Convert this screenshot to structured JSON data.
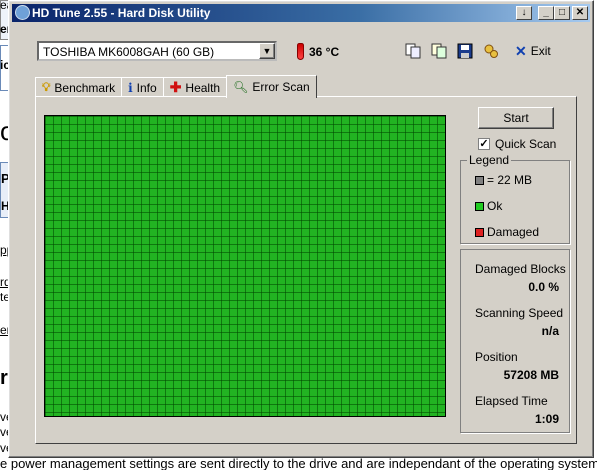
{
  "background": {
    "frag_top1": "ea",
    "frag_top2": "emp",
    "frag_ice": "ice",
    "frag_o": "o",
    "frag_pr": "Pr",
    "frag_hd": "HD",
    "frag_ppo": "ppo",
    "frag_rdw": "rdw",
    "frag_te": "te:",
    "frag_ens": "ens",
    "frag_riv": "riv",
    "frag_ve": "ve",
    "frag_ves1": "ves.",
    "frag_ves2": "ves.",
    "frag_right1": ",",
    "bottom_text": "e power management settings are sent directly to the drive and are independant of the operating system"
  },
  "window": {
    "title": "HD Tune 2.55 - Hard Disk Utility",
    "btn_help": "↓",
    "btn_min": "_",
    "btn_max": "□",
    "btn_close": "✕"
  },
  "toolbar": {
    "drive": "TOSHIBA MK6008GAH (60 GB)",
    "temperature": "36 °C",
    "exit_label": "Exit"
  },
  "tabs": [
    {
      "label": "Benchmark",
      "icon": "benchmark-icon"
    },
    {
      "label": "Info",
      "icon": "info-icon"
    },
    {
      "label": "Health",
      "icon": "health-icon"
    },
    {
      "label": "Error Scan",
      "icon": "magnifier-icon",
      "active": true
    }
  ],
  "scan": {
    "start_label": "Start",
    "quick_scan_label": "Quick Scan",
    "quick_scan_checked": true,
    "block_color": "#22b322"
  },
  "legend": {
    "title": "Legend",
    "items": [
      {
        "label": "= 22 MB",
        "color": "#808080"
      },
      {
        "label": "Ok",
        "color": "#22cc22"
      },
      {
        "label": "Damaged",
        "color": "#dd2222"
      }
    ]
  },
  "stats": {
    "damaged_label": "Damaged Blocks",
    "damaged_value": "0.0 %",
    "speed_label": "Scanning Speed",
    "speed_value": "n/a",
    "position_label": "Position",
    "position_value": "57208 MB",
    "elapsed_label": "Elapsed Time",
    "elapsed_value": "1:09"
  }
}
